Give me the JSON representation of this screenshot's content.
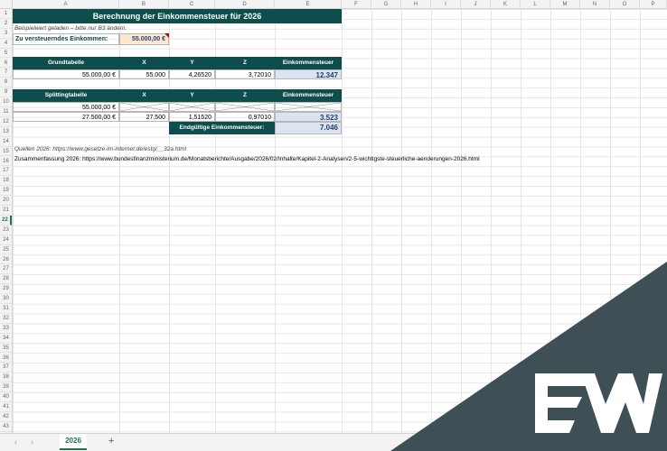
{
  "columns": [
    "A",
    "B",
    "C",
    "D",
    "E",
    "F",
    "G",
    "H",
    "I",
    "J",
    "K",
    "L",
    "M",
    "N",
    "O",
    "P"
  ],
  "rows": [
    "1",
    "2",
    "3",
    "4",
    "5",
    "6",
    "7",
    "8",
    "9",
    "10",
    "11",
    "12",
    "13",
    "14",
    "15",
    "16",
    "17",
    "18",
    "19",
    "20",
    "21",
    "22",
    "23",
    "24",
    "25",
    "26",
    "27",
    "28",
    "29",
    "30",
    "31",
    "32",
    "33",
    "34",
    "35",
    "36",
    "37",
    "38",
    "39",
    "40",
    "41",
    "42",
    "43"
  ],
  "active_row": "22",
  "sheet": {
    "title": "Berechnung der Einkommensteuer für 2026",
    "note": "Beispielwert geladen – bitte nur B3 ändern.",
    "input_label": "Zu versteuerndes Einkommen:",
    "input_value": "55.000,00 €",
    "grund": {
      "headers": [
        "Grundtabelle",
        "X",
        "Y",
        "Z",
        "Einkommensteuer"
      ],
      "row": [
        "55.000,00 €",
        "55.000",
        "4,26520",
        "3,72010",
        "12.347"
      ]
    },
    "splitting": {
      "headers": [
        "Splittingtabelle",
        "X",
        "Y",
        "Z",
        "Einkommensteuer"
      ],
      "row1_a": "55.000,00 €",
      "row2": [
        "27.500,00 €",
        "27.500",
        "1,51520",
        "0,97010",
        "3.523"
      ],
      "final_label": "Endgültige Einkommensteuer:",
      "final_value": "7.046"
    },
    "source_note": "Quellen 2026: https://www.gesetze-im-internet.de/estg/__32a.html",
    "summary_note": "Zusammenfassung 2026: https://www.bundesfinanzministerium.de/Monatsberichte/Ausgabe/2026/02/Inhalte/Kapitel-2-Analysen/2-5-wichtigste-steuerliche-aenderungen-2026.html"
  },
  "tabs": {
    "active": "2026",
    "prev": "‹",
    "next": "›",
    "add": "+"
  }
}
